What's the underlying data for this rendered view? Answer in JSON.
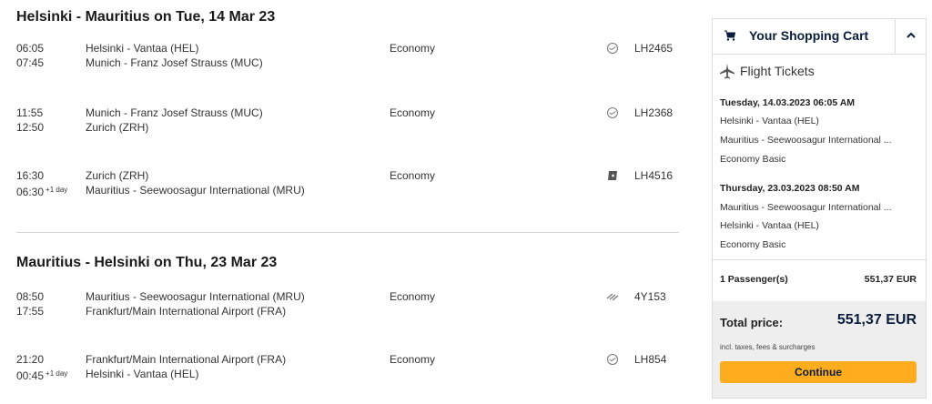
{
  "outbound": {
    "title": "Helsinki - Mauritius on Tue, 14 Mar 23",
    "segments": [
      {
        "dep_time": "06:05",
        "arr_time": "07:45",
        "arr_plus": "",
        "from": "Helsinki - Vantaa (HEL)",
        "to": "Munich - Franz Josef Strauss (MUC)",
        "cabin": "Economy",
        "airline_icon": "lufthansa-crane-icon",
        "flight": "LH2465"
      },
      {
        "dep_time": "11:55",
        "arr_time": "12:50",
        "arr_plus": "",
        "from": "Munich - Franz Josef Strauss (MUC)",
        "to": "Zurich (ZRH)",
        "cabin": "Economy",
        "airline_icon": "lufthansa-crane-icon",
        "flight": "LH2368"
      },
      {
        "dep_time": "16:30",
        "arr_time": "06:30",
        "arr_plus": "+1 day",
        "from": "Zurich (ZRH)",
        "to": "Mauritius - Seewoosagur International (MRU)",
        "cabin": "Economy",
        "airline_icon": "swiss-logo-icon",
        "flight": "LH4516"
      }
    ]
  },
  "inbound": {
    "title": "Mauritius - Helsinki on Thu, 23 Mar 23",
    "segments": [
      {
        "dep_time": "08:50",
        "arr_time": "17:55",
        "arr_plus": "",
        "from": "Mauritius - Seewoosagur International (MRU)",
        "to": "Frankfurt/Main International Airport (FRA)",
        "cabin": "Economy",
        "airline_icon": "discover-wings-icon",
        "flight": "4Y153"
      },
      {
        "dep_time": "21:20",
        "arr_time": "00:45",
        "arr_plus": "+1 day",
        "from": "Frankfurt/Main International Airport (FRA)",
        "to": "Helsinki - Vantaa (HEL)",
        "cabin": "Economy",
        "airline_icon": "lufthansa-crane-icon",
        "flight": "LH854"
      }
    ]
  },
  "cart": {
    "title": "Your Shopping Cart",
    "section": "Flight Tickets",
    "lines": [
      "Tuesday, 14.03.2023 06:05 AM",
      "Helsinki - Vantaa (HEL)",
      "Mauritius - Seewoosagur International ...",
      "Economy Basic",
      "Thursday, 23.03.2023 08:50 AM",
      "Mauritius - Seewoosagur International ...",
      "Helsinki - Vantaa (HEL)",
      "Economy Basic"
    ],
    "passengers": "1 Passenger(s)",
    "passenger_price": "551,37 EUR",
    "total_label": "Total price:",
    "total_value": "551,37 EUR",
    "total_note": "incl. taxes, fees & surcharges",
    "continue_label": "Continue"
  },
  "colors": {
    "accent": "#ffad1f",
    "brand": "#0a1d3d"
  }
}
